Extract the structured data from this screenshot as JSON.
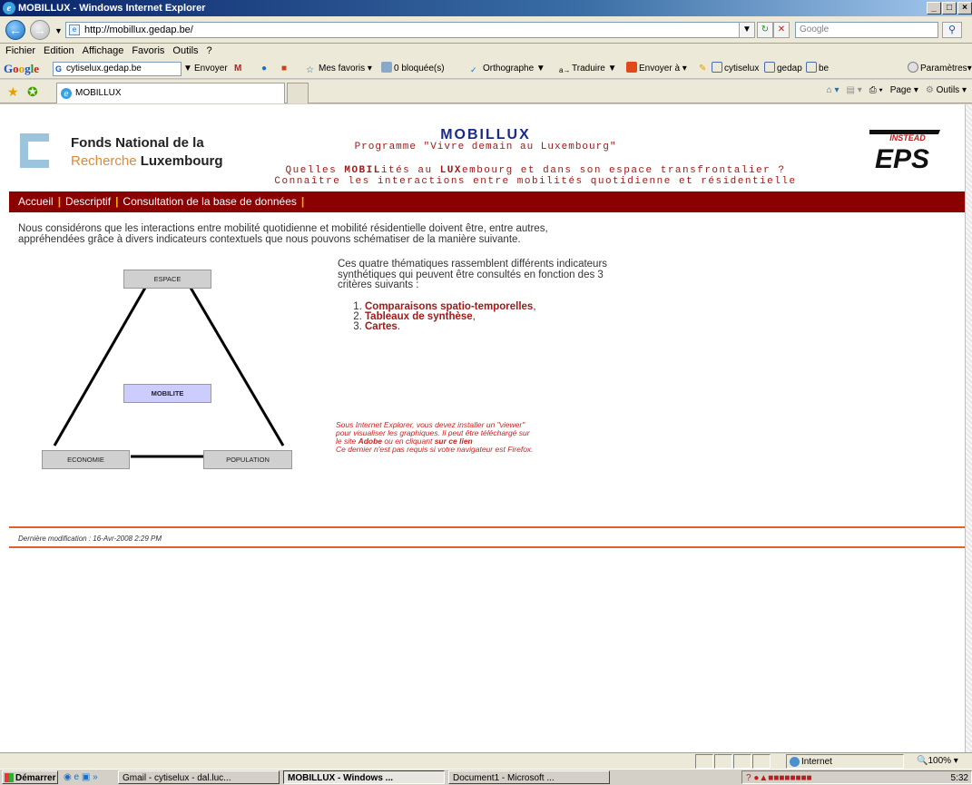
{
  "window": {
    "title": "MOBILLUX - Windows Internet Explorer",
    "min": "_",
    "max": "□",
    "close": "×"
  },
  "address": {
    "url": "http://mobillux.gedap.be/",
    "search_placeholder": "Google"
  },
  "menu": [
    "Fichier",
    "Edition",
    "Affichage",
    "Favoris",
    "Outils",
    "?"
  ],
  "google_toolbar": {
    "logo": [
      "G",
      "o",
      "o",
      "g",
      "l",
      "e"
    ],
    "search_value": "cytiselux.gedap.be",
    "envoyer": "Envoyer",
    "mes_favoris": "Mes favoris",
    "bloquees": "0 bloquée(s)",
    "orthographe": "Orthographe",
    "traduire": "Traduire",
    "envoyer_a": "Envoyer à",
    "bm1": "cytiselux",
    "bm2": "gedap",
    "bm3": "be",
    "parametres": "Paramètres"
  },
  "tab": {
    "label": "MOBILLUX"
  },
  "cmdbar": {
    "page": "Page",
    "outils": "Outils"
  },
  "header": {
    "fnr_line1": "Fonds National de la",
    "fnr_line2a": "Recherche",
    "fnr_line2b": "Luxembourg",
    "title": "MOBILLUX",
    "subtitle": "Programme \"Vivre demain au Luxembourg\"",
    "tag1_a": "Quelles ",
    "tag1_b": "MOBIL",
    "tag1_c": "ités au ",
    "tag1_d": "LUX",
    "tag1_e": "embourg et dans son espace transfrontalier ?",
    "tag2": "Connaître les interactions entre mobilités quotidienne et résidentielle",
    "epfl_top": "INSTEAD",
    "epfl_mark": "EPS"
  },
  "nav": [
    "Accueil",
    "Descriptif",
    "Consultation de la base de données"
  ],
  "nav_sep": "|",
  "content": {
    "intro": "Nous considérons que les interactions entre mobilité quotidienne et mobilité résidentielle doivent être, entre autres, appréhendées grâce à divers indicateurs contextuels que nous pouvons schématiser de la manière suivante.",
    "right_text": "Ces quatre thématiques rassemblent différents indicateurs synthétiques qui peuvent être consultés en fonction des 3 critères suivants :",
    "criteria": [
      {
        "label": "Comparaisons spatio-temporelles",
        "suffix": ","
      },
      {
        "label": "Tableaux de synthèse",
        "suffix": ","
      },
      {
        "label": "Cartes",
        "suffix": "."
      }
    ],
    "note_1": "Sous Internet Explorer, vous devez installer un \"viewer\"",
    "note_2": "pour visualiser les graphiques. Il peut être téléchargé sur",
    "note_3a": "le site ",
    "note_3b": "Adobe",
    "note_3c": " ou en cliquant ",
    "note_3d": "sur ce lien",
    "note_4": "Ce dernier n'est pas requis si votre navigateur est Firefox."
  },
  "diagram": {
    "espace": "ESPACE",
    "mobilite": "MOBILITE",
    "economie": "ECONOMIE",
    "population": "POPULATION",
    "mobilite_color": "#ccccff"
  },
  "footer": {
    "lastmod": "Dernière modification : 16-Avr-2008 2:29 PM"
  },
  "status": {
    "zone": "Internet",
    "zoom": "100%"
  },
  "taskbar": {
    "start": "Démarrer",
    "task1": "Gmail - cytiselux - dal.luc...",
    "task2": "MOBILLUX - Windows ...",
    "task3": "Document1 - Microsoft ...",
    "clock": "5:32"
  },
  "colors": {
    "nav_bg": "#8b0000",
    "accent_red": "#a01a1a",
    "title_blue": "#1a2a8a",
    "rule_orange": "#e0642a"
  }
}
